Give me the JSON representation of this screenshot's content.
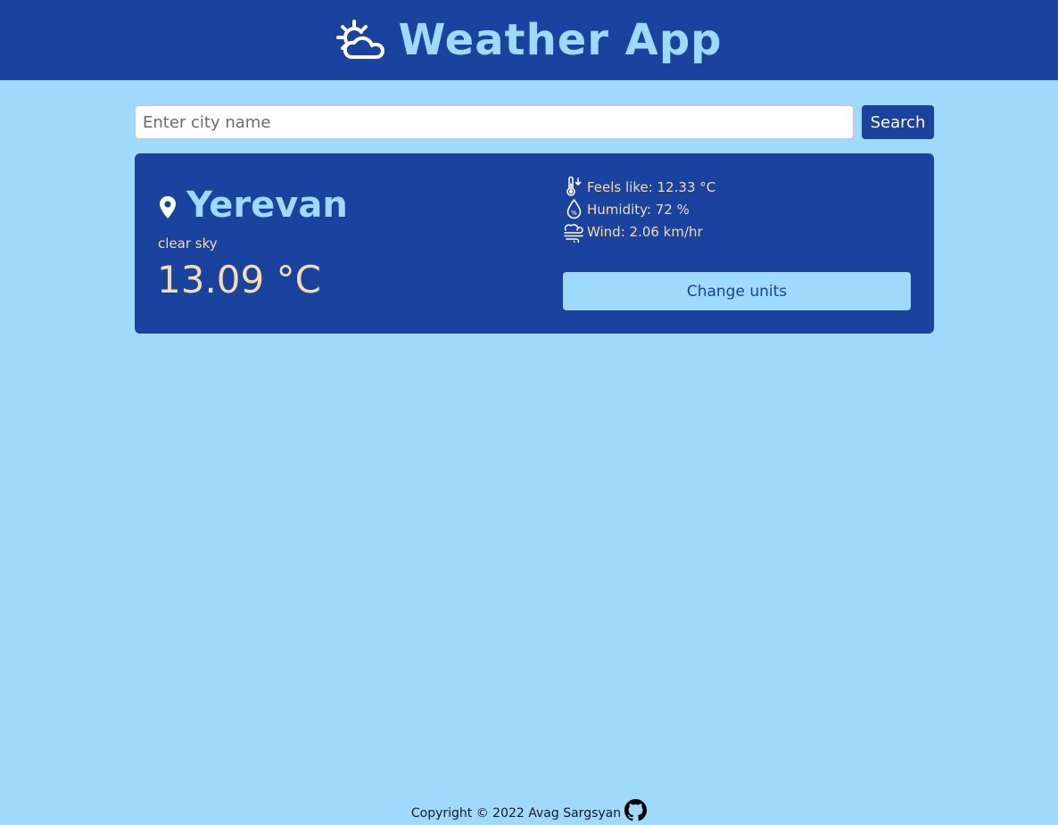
{
  "header": {
    "title": "Weather App",
    "logo_icon": "sun-cloud-icon"
  },
  "search": {
    "placeholder": "Enter city name",
    "value": "",
    "button_label": "Search"
  },
  "weather": {
    "city": "Yerevan",
    "location_icon": "map-pin-icon",
    "description": "clear sky",
    "temperature": "13.09 °C",
    "details": [
      {
        "icon": "thermometer-icon",
        "text": "Feels like: 12.33 °C"
      },
      {
        "icon": "humidity-drop-icon",
        "text": "Humidity: 72 %"
      },
      {
        "icon": "wind-icon",
        "text": "Wind: 2.06 km/hr"
      }
    ],
    "units_button_label": "Change units"
  },
  "footer": {
    "copyright": "Copyright © 2022 Avag Sargsyan",
    "link_icon": "github-icon"
  },
  "colors": {
    "page_background": "#9fd9fb",
    "primary": "#1a43a0",
    "accent_text": "#f5dcac",
    "title_text": "#9fd9fb"
  }
}
